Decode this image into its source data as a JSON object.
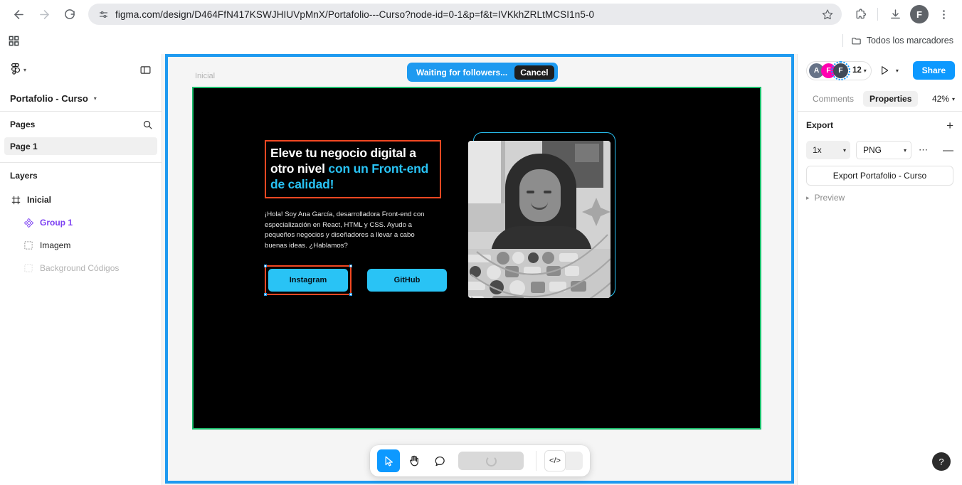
{
  "browser": {
    "url": "figma.com/design/D464FfN417KSWJHIUVpMnX/Portafolio---Curso?node-id=0-1&p=f&t=IVKkhZRLtMCSI1n5-0",
    "back_icon": "back-arrow-icon",
    "forward_icon": "forward-arrow-icon",
    "reload_icon": "reload-icon",
    "site_info_icon": "site-settings-icon",
    "star_icon": "bookmark-star-icon",
    "extensions_icon": "extensions-puzzle-icon",
    "downloads_icon": "downloads-icon",
    "menu_icon": "three-dot-menu-icon",
    "profile_initial": "F",
    "apps_grid_icon": "apps-grid-icon",
    "bookmarks_folder_icon": "folder-icon",
    "all_bookmarks_label": "Todos los marcadores"
  },
  "left_panel": {
    "figma_logo_icon": "figma-logo-icon",
    "main_menu_chevron": "chevron-down-icon",
    "panel_toggle_icon": "toggle-panel-icon",
    "file_name": "Portafolio - Curso",
    "file_chevron": "chevron-down-icon",
    "pages_label": "Pages",
    "pages_search_icon": "search-icon",
    "pages": [
      {
        "label": "Page 1",
        "selected": true
      }
    ],
    "layers_label": "Layers",
    "layers": [
      {
        "label": "Inicial",
        "icon": "frame-icon",
        "type": "frame"
      },
      {
        "label": "Group 1",
        "icon": "group-icon",
        "type": "group"
      },
      {
        "label": "Imagem",
        "icon": "image-placeholder-icon",
        "type": "child"
      },
      {
        "label": "Background Códigos",
        "icon": "image-placeholder-icon",
        "type": "child-hidden"
      }
    ]
  },
  "canvas": {
    "frame_label": "Inicial",
    "frame_border_color": "#1abc6b",
    "share_border_color": "#1e9af0",
    "artboard_background": "#000000",
    "selection_color": "#f24822",
    "accent_color": "#29c3f5",
    "headline_part1": "Eleve tu negocio digital a otro nivel ",
    "headline_part2": "con un Front-end de calidad!",
    "bio": "¡Hola! Soy Ana García, desarrolladora Front-end con especialización en React, HTML y CSS. Ayudo a pequeños negocios y diseñadores a llevar a cabo buenas ideas. ¿Hablamos?",
    "cta_primary": "Instagram",
    "cta_secondary": "GitHub",
    "photo_alt": "woman-at-laptop-photo"
  },
  "banner": {
    "message": "Waiting for followers...",
    "cancel_label": "Cancel",
    "background": "#1e9af0"
  },
  "toolbar": {
    "tools": [
      {
        "name": "move-tool",
        "icon": "cursor-icon",
        "active": true
      },
      {
        "name": "hand-tool",
        "icon": "hand-icon",
        "active": false
      },
      {
        "name": "comment-tool",
        "icon": "comment-bubble-icon",
        "active": false
      }
    ],
    "loading_icon": "loading-spinner-icon",
    "code_icon": "code-brackets-icon"
  },
  "help": {
    "label": "?"
  },
  "right_panel": {
    "avatars": [
      {
        "initial": "A",
        "color": "#667287"
      },
      {
        "initial": "F",
        "color": "#ff00b0"
      },
      {
        "initial": "F",
        "color": "#3f4a57",
        "selected": true
      }
    ],
    "avatar_count": "12",
    "avatar_chevron": "chevron-down-icon",
    "present_icon": "play-present-icon",
    "present_chevron": "chevron-down-icon",
    "share_label": "Share",
    "tabs": [
      {
        "label": "Comments",
        "active": false
      },
      {
        "label": "Properties",
        "active": true
      }
    ],
    "zoom": "42%",
    "zoom_chevron": "chevron-down-icon",
    "export_label": "Export",
    "export_add_icon": "plus-icon",
    "export_scale": "1x",
    "export_format": "PNG",
    "export_more_icon": "ellipsis-icon",
    "export_remove_icon": "minus-icon",
    "export_button_label": "Export Portafolio - Curso",
    "preview_label": "Preview",
    "preview_chevron": "chevron-right-icon"
  }
}
